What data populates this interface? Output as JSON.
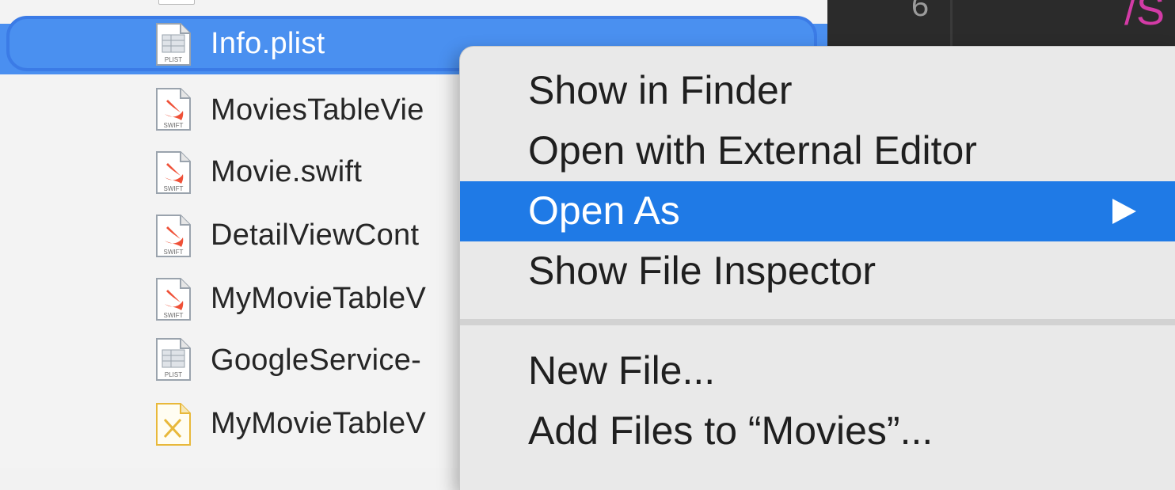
{
  "navigator": {
    "files": [
      {
        "name": "Info.plist",
        "type": "PLIST",
        "selected": true
      },
      {
        "name": "MoviesTableVie",
        "type": "SWIFT"
      },
      {
        "name": "Movie.swift",
        "type": "SWIFT"
      },
      {
        "name": "DetailViewCont",
        "type": "SWIFT"
      },
      {
        "name": "MyMovieTableV",
        "type": "SWIFT"
      },
      {
        "name": "GoogleService-",
        "type": "PLIST"
      },
      {
        "name": "MyMovieTableV",
        "type": "XIB"
      }
    ]
  },
  "editor": {
    "line_number": "6",
    "code_fragment": "/S"
  },
  "context_menu": {
    "items": [
      {
        "label": "Show in Finder"
      },
      {
        "label": "Open with External Editor"
      },
      {
        "label": "Open As",
        "highlighted": true,
        "submenu": true
      },
      {
        "label": "Show File Inspector"
      },
      {
        "label": "New File..."
      },
      {
        "label": "Add Files to “Movies”..."
      }
    ]
  },
  "colors": {
    "selection": "#4a8ff0",
    "menu_highlight": "#1f7ae6",
    "swift_icon": "#ef5138",
    "xib_icon": "#e8b83a"
  }
}
